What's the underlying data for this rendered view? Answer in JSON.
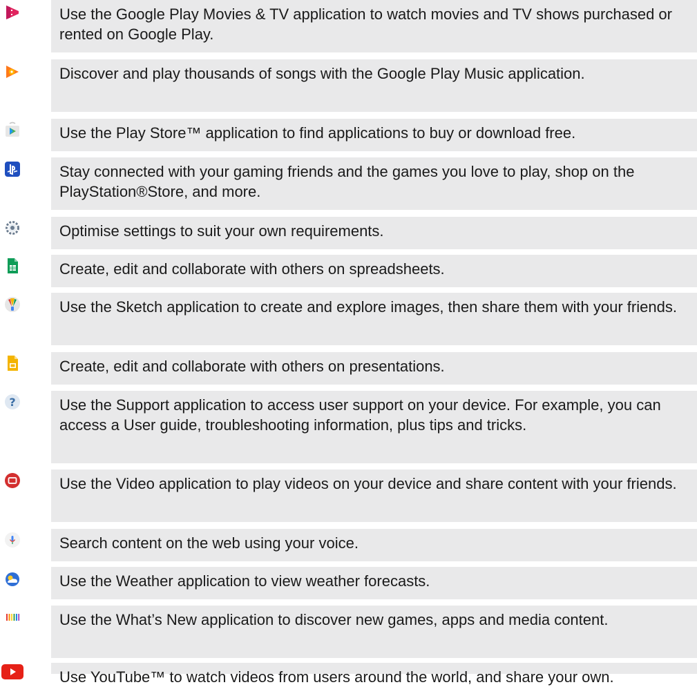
{
  "apps": [
    {
      "icon": "play-movies-icon",
      "text": "Use the Google Play Movies & TV application to watch movies and TV shows purchased or rented on Google Play."
    },
    {
      "icon": "play-music-icon",
      "text": "Discover and play thousands of songs with the Google Play Music application."
    },
    {
      "icon": "play-store-icon",
      "text": "Use the Play Store™ application to find applications to buy or download free."
    },
    {
      "icon": "playstation-icon",
      "text": "Stay connected with your gaming friends and the games you love to play, shop on the PlayStation®Store, and more."
    },
    {
      "icon": "settings-gear-icon",
      "text": "Optimise settings to suit your own requirements."
    },
    {
      "icon": "sheets-icon",
      "text": "Create, edit and collaborate with others on spreadsheets."
    },
    {
      "icon": "sketch-icon",
      "text": "Use the Sketch application to create and explore images, then share them with your friends."
    },
    {
      "icon": "slides-icon",
      "text": "Create, edit and collaborate with others on presentations."
    },
    {
      "icon": "support-question-icon",
      "text": "Use the Support application to access user support on your device. For example, you can access a User guide, troubleshooting information, plus tips and tricks."
    },
    {
      "icon": "video-icon",
      "text": "Use the Video application to play videos on your device and share content with your friends."
    },
    {
      "icon": "voice-search-mic-icon",
      "text": "Search content on the web using your voice."
    },
    {
      "icon": "weather-icon",
      "text": "Use the Weather application to view weather forecasts."
    },
    {
      "icon": "whats-new-icon",
      "text": "Use the What’s New application to discover new games, apps and media content."
    },
    {
      "icon": "youtube-icon",
      "text": "Use YouTube™ to watch videos from users around the world, and share your own."
    }
  ]
}
